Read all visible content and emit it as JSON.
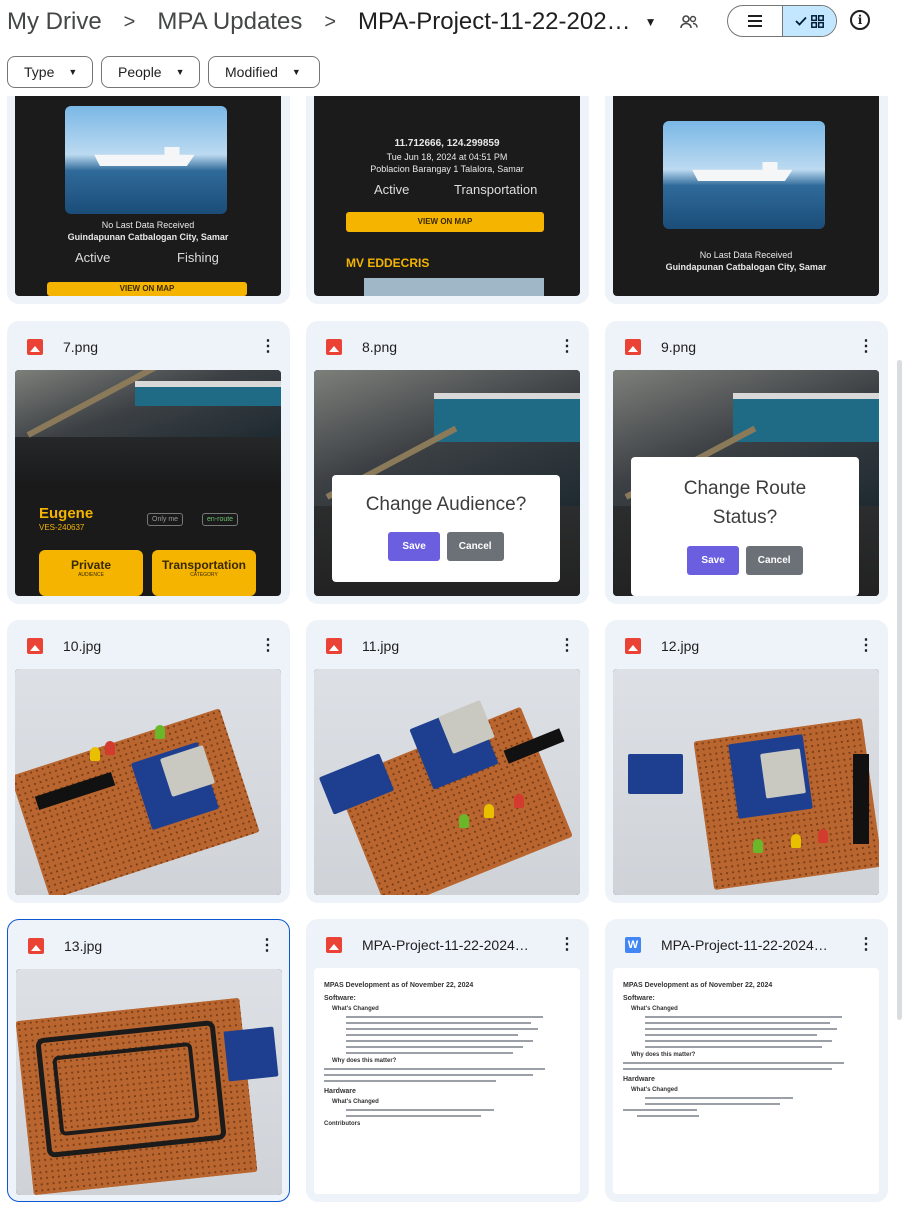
{
  "breadcrumb": {
    "items": [
      "My Drive",
      "MPA Updates",
      "MPA-Project-11-22-202…"
    ],
    "separator": ">"
  },
  "toolbar": {
    "view_list_icon": "list-icon",
    "view_grid_icon": "grid-icon",
    "info_label": "i"
  },
  "filters": [
    {
      "label": "Type"
    },
    {
      "label": "People"
    },
    {
      "label": "Modified"
    }
  ],
  "top_row": [
    {
      "received": "No Last Data Received",
      "place": "Guindapunan Catbalogan City, Samar",
      "status": "Active",
      "category": "Fishing",
      "button": "VIEW ON MAP"
    },
    {
      "coords": "11.712666, 124.299859",
      "received": "Tue Jun 18, 2024 at 04:51 PM",
      "place": "Poblacion Barangay 1 Talalora, Samar",
      "status": "Active",
      "category": "Transportation",
      "button": "VIEW ON MAP",
      "vessel": "MV EDDECRIS"
    },
    {
      "received": "No Last Data Received",
      "place": "Guindapunan Catbalogan City, Samar"
    }
  ],
  "files": [
    {
      "name": "7.png",
      "type": "image",
      "vessel": "Eugene",
      "id": "VES-240637",
      "tag1": "Only me",
      "tag2": "en-route",
      "status": "Private",
      "status_sub": "AUDIENCE",
      "category": "Transportation",
      "category_sub": "CATEGORY"
    },
    {
      "name": "8.png",
      "type": "image",
      "dialog": "Change Audience?",
      "save": "Save",
      "cancel": "Cancel"
    },
    {
      "name": "9.png",
      "type": "image",
      "dialog": "Change Route Status?",
      "save": "Save",
      "cancel": "Cancel"
    },
    {
      "name": "10.jpg",
      "type": "image"
    },
    {
      "name": "11.jpg",
      "type": "image"
    },
    {
      "name": "12.jpg",
      "type": "image"
    },
    {
      "name": "13.jpg",
      "type": "image"
    },
    {
      "name": "MPA-Project-11-22-2024…",
      "type": "pdf",
      "doc_title": "MPAS Development as of November 22, 2024",
      "h1": "Software:",
      "h2": "What's Changed",
      "h3": "Why does this matter?",
      "h4": "Hardware",
      "h5": "What's Changed",
      "h6": "Contributors"
    },
    {
      "name": "MPA-Project-11-22-2024…",
      "type": "doc",
      "doc_icon": "W",
      "doc_title": "MPAS Development as of November 22, 2024",
      "h1": "Software:",
      "h2": "What's Changed",
      "h3": "Why does this matter?",
      "h4": "Hardware",
      "h5": "What's Changed"
    }
  ]
}
